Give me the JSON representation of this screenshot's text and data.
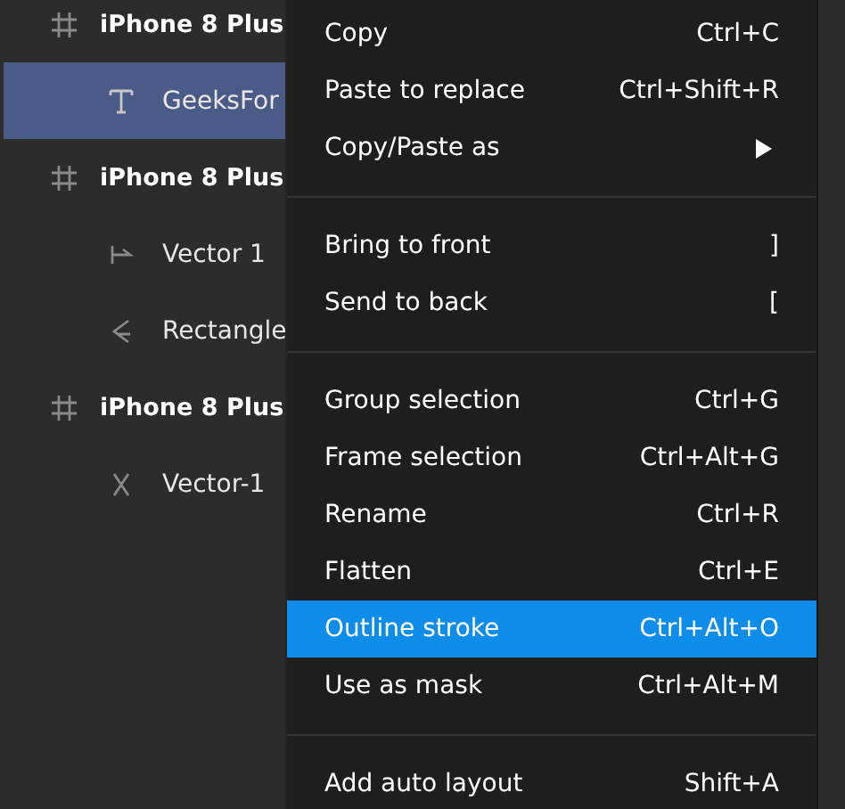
{
  "layers": [
    {
      "name": "iPhone 8 Plus",
      "kind": "frame",
      "selected": false,
      "children": [
        {
          "name": "GeeksFor",
          "kind": "text",
          "selected": true
        }
      ]
    },
    {
      "name": "iPhone 8 Plus",
      "kind": "frame",
      "selected": false,
      "children": [
        {
          "name": "Vector 1",
          "kind": "line",
          "selected": false
        },
        {
          "name": "Rectangle",
          "kind": "shape",
          "selected": false
        }
      ]
    },
    {
      "name": "iPhone 8 Plus",
      "kind": "frame",
      "selected": false,
      "children": [
        {
          "name": "Vector-1",
          "kind": "vector",
          "selected": false
        }
      ]
    }
  ],
  "context_menu": {
    "sections": [
      [
        {
          "label": "Copy",
          "shortcut": "Ctrl+C",
          "selected": false,
          "submenu": false
        },
        {
          "label": "Paste to replace",
          "shortcut": "Ctrl+Shift+R",
          "selected": false,
          "submenu": false
        },
        {
          "label": "Copy/Paste as",
          "selected": false,
          "submenu": true
        }
      ],
      [
        {
          "label": "Bring to front",
          "shortcut": "]",
          "selected": false,
          "submenu": false
        },
        {
          "label": "Send to back",
          "shortcut": "[",
          "selected": false,
          "submenu": false
        }
      ],
      [
        {
          "label": "Group selection",
          "shortcut": "Ctrl+G",
          "selected": false,
          "submenu": false
        },
        {
          "label": "Frame selection",
          "shortcut": "Ctrl+Alt+G",
          "selected": false,
          "submenu": false
        },
        {
          "label": "Rename",
          "shortcut": "Ctrl+R",
          "selected": false,
          "submenu": false
        },
        {
          "label": "Flatten",
          "shortcut": "Ctrl+E",
          "selected": false,
          "submenu": false
        },
        {
          "label": "Outline stroke",
          "shortcut": "Ctrl+Alt+O",
          "selected": true,
          "submenu": false
        },
        {
          "label": "Use as mask",
          "shortcut": "Ctrl+Alt+M",
          "selected": false,
          "submenu": false
        }
      ],
      [
        {
          "label": "Add auto layout",
          "shortcut": "Shift+A",
          "selected": false,
          "submenu": false
        }
      ]
    ]
  }
}
